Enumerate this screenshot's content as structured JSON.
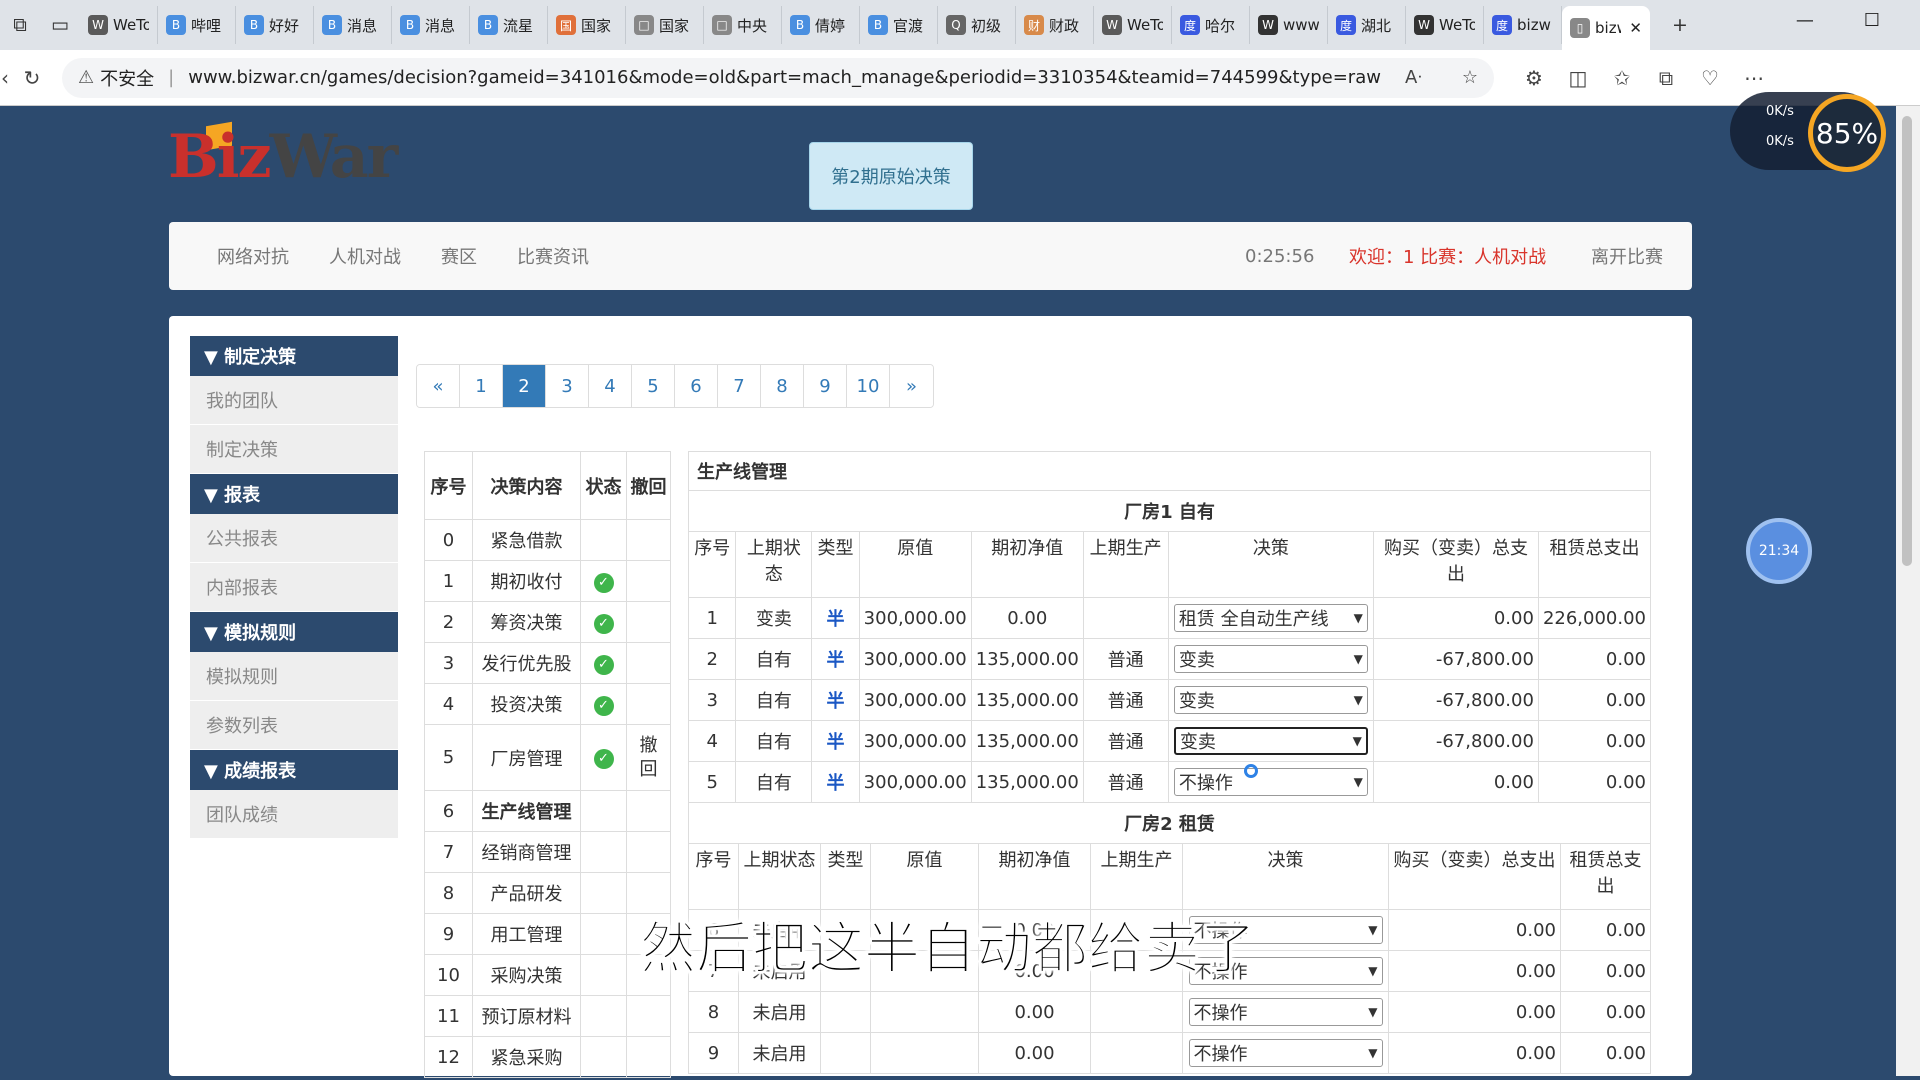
{
  "browser": {
    "tabs": [
      {
        "label": "WeTo",
        "fav": "W"
      },
      {
        "label": "哔哩",
        "fav": "B"
      },
      {
        "label": "好好",
        "fav": "B"
      },
      {
        "label": "消息",
        "fav": "B"
      },
      {
        "label": "消息",
        "fav": "B"
      },
      {
        "label": "流星",
        "fav": "B"
      },
      {
        "label": "国家",
        "fav": "国"
      },
      {
        "label": "国家",
        "fav": "□"
      },
      {
        "label": "中央",
        "fav": "□"
      },
      {
        "label": "倩婷",
        "fav": "B"
      },
      {
        "label": "官渡",
        "fav": "B"
      },
      {
        "label": "初级",
        "fav": "Q"
      },
      {
        "label": "财政",
        "fav": "财"
      },
      {
        "label": "WeTo",
        "fav": "W"
      },
      {
        "label": "哈尔",
        "fav": "度"
      },
      {
        "label": "www",
        "fav": "W"
      },
      {
        "label": "湖北",
        "fav": "度"
      },
      {
        "label": "WeTo",
        "fav": "W"
      },
      {
        "label": "bizw",
        "fav": "度"
      }
    ],
    "active_tab": {
      "label": "bizw"
    },
    "new_tab": "+",
    "insecure_label": "不安全",
    "url": "www.bizwar.cn/games/decision?gameid=341016&mode=old&part=mach_manage&periodid=3310354&teamid=744599&type=raw"
  },
  "logo": {
    "biz": "Biz",
    "war": "War"
  },
  "period_button": "第2期原始决策",
  "nav": {
    "items": [
      "网络对抗",
      "人机对战",
      "赛区",
      "比赛资讯"
    ],
    "time": "0:25:56",
    "welcome": "欢迎：1 比赛：人机对战",
    "leave": "离开比赛"
  },
  "sidebar": [
    {
      "head": "▼ 制定决策",
      "items": [
        "我的团队",
        "制定决策"
      ]
    },
    {
      "head": "▼ 报表",
      "items": [
        "公共报表",
        "内部报表"
      ]
    },
    {
      "head": "▼ 模拟规则",
      "items": [
        "模拟规则",
        "参数列表"
      ]
    },
    {
      "head": "▼ 成绩报表",
      "items": [
        "团队成绩"
      ]
    }
  ],
  "pager": [
    "«",
    "1",
    "2",
    "3",
    "4",
    "5",
    "6",
    "7",
    "8",
    "9",
    "10",
    "»"
  ],
  "pager_active": "2",
  "left_table": {
    "headers": [
      "序号",
      "决策内容",
      "状态",
      "撤回"
    ],
    "rows": [
      {
        "n": "0",
        "c": "紧急借款",
        "s": false,
        "r": ""
      },
      {
        "n": "1",
        "c": "期初收付",
        "s": true,
        "r": ""
      },
      {
        "n": "2",
        "c": "筹资决策",
        "s": true,
        "r": ""
      },
      {
        "n": "3",
        "c": "发行优先股",
        "s": true,
        "r": ""
      },
      {
        "n": "4",
        "c": "投资决策",
        "s": true,
        "r": ""
      },
      {
        "n": "5",
        "c": "厂房管理",
        "s": true,
        "r": "撤回"
      },
      {
        "n": "6",
        "c": "生产线管理",
        "s": false,
        "r": "",
        "bold": true
      },
      {
        "n": "7",
        "c": "经销商管理",
        "s": false,
        "r": ""
      },
      {
        "n": "8",
        "c": "产品研发",
        "s": false,
        "r": ""
      },
      {
        "n": "9",
        "c": "用工管理",
        "s": false,
        "r": ""
      },
      {
        "n": "10",
        "c": "采购决策",
        "s": false,
        "r": ""
      },
      {
        "n": "11",
        "c": "预订原材料",
        "s": false,
        "r": ""
      },
      {
        "n": "12",
        "c": "紧急采购",
        "s": false,
        "r": ""
      }
    ]
  },
  "right": {
    "title": "生产线管理",
    "headers": [
      "序号",
      "上期状态",
      "类型",
      "原值",
      "期初净值",
      "上期生产",
      "决策",
      "购买（变卖）总支出",
      "租赁总支出"
    ],
    "factory1": {
      "title": "厂房1 自有",
      "rows": [
        {
          "n": "1",
          "st": "变卖",
          "ty": "半",
          "ov": "300,000.00",
          "nv": "0.00",
          "pp": "",
          "dec": "租赁 全自动生产线",
          "buy": "0.00",
          "rent": "226,000.00"
        },
        {
          "n": "2",
          "st": "自有",
          "ty": "半",
          "ov": "300,000.00",
          "nv": "135,000.00",
          "pp": "普通",
          "dec": "变卖",
          "buy": "-67,800.00",
          "rent": "0.00"
        },
        {
          "n": "3",
          "st": "自有",
          "ty": "半",
          "ov": "300,000.00",
          "nv": "135,000.00",
          "pp": "普通",
          "dec": "变卖",
          "buy": "-67,800.00",
          "rent": "0.00"
        },
        {
          "n": "4",
          "st": "自有",
          "ty": "半",
          "ov": "300,000.00",
          "nv": "135,000.00",
          "pp": "普通",
          "dec": "变卖",
          "buy": "-67,800.00",
          "rent": "0.00",
          "focus": true
        },
        {
          "n": "5",
          "st": "自有",
          "ty": "半",
          "ov": "300,000.00",
          "nv": "135,000.00",
          "pp": "普通",
          "dec": "不操作",
          "buy": "0.00",
          "rent": "0.00"
        }
      ]
    },
    "factory2": {
      "title": "厂房2 租赁",
      "rows": [
        {
          "n": "6",
          "st": "未启用",
          "ty": "",
          "ov": "",
          "nv": "0.00",
          "pp": "",
          "dec": "不操作",
          "buy": "0.00",
          "rent": "0.00"
        },
        {
          "n": "7",
          "st": "未启用",
          "ty": "",
          "ov": "",
          "nv": "0.00",
          "pp": "",
          "dec": "不操作",
          "buy": "0.00",
          "rent": "0.00"
        },
        {
          "n": "8",
          "st": "未启用",
          "ty": "",
          "ov": "",
          "nv": "0.00",
          "pp": "",
          "dec": "不操作",
          "buy": "0.00",
          "rent": "0.00"
        },
        {
          "n": "9",
          "st": "未启用",
          "ty": "",
          "ov": "",
          "nv": "0.00",
          "pp": "",
          "dec": "不操作",
          "buy": "0.00",
          "rent": "0.00"
        }
      ]
    }
  },
  "subtitle": "然后把这半自动都给卖了",
  "overlay": {
    "speed_up": "0K/s",
    "speed_down": "0K/s",
    "gauge": "85%",
    "clock": "21:34"
  }
}
